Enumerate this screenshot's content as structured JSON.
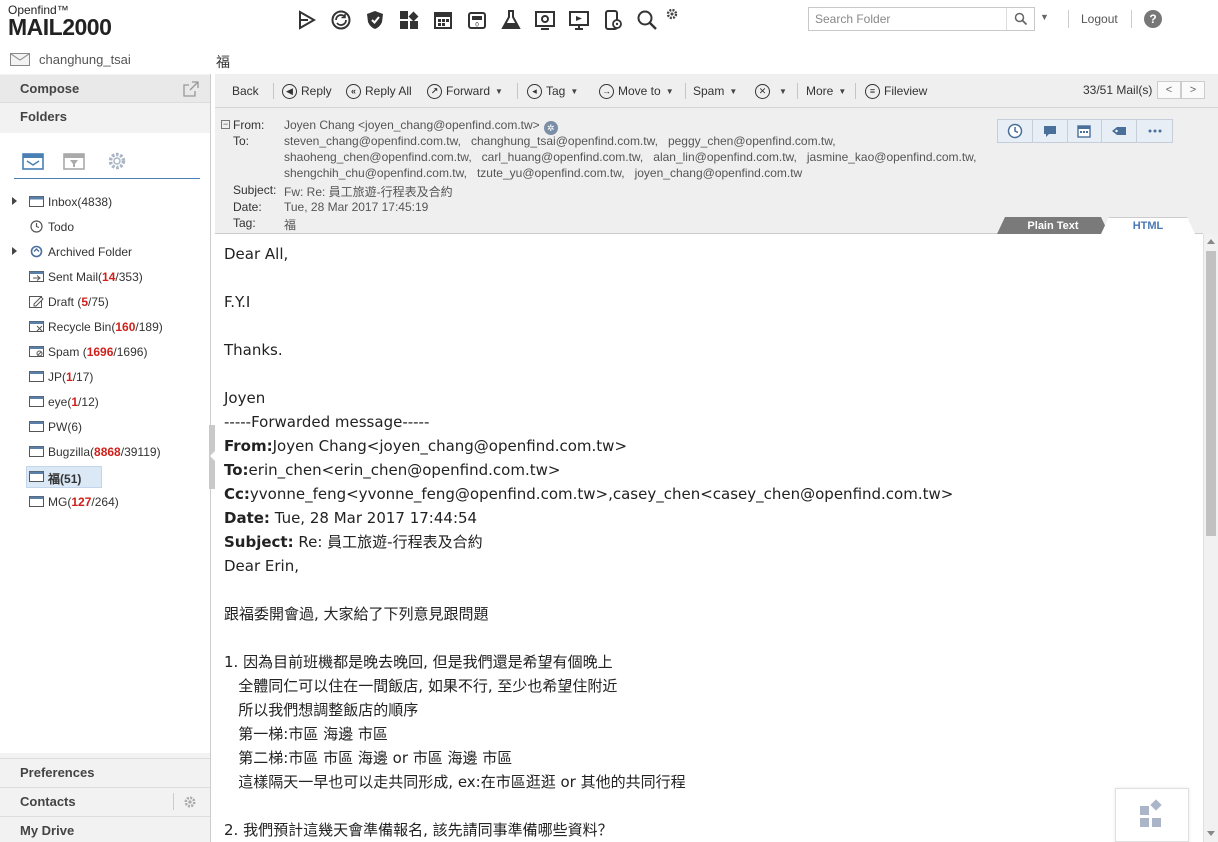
{
  "app": {
    "brand": "Openfind™",
    "product": "MAIL2000"
  },
  "top_icons": [
    "send-icon",
    "sync-icon",
    "shield-icon",
    "modules-icon",
    "calendar-icon",
    "calculator-icon",
    "lab-flask-icon",
    "settings-panel-icon",
    "presentation-icon",
    "phone-settings-icon",
    "search-icon",
    "gear-icon"
  ],
  "search": {
    "placeholder": "Search Folder",
    "value": ""
  },
  "header_links": {
    "logout": "Logout",
    "help": "?"
  },
  "user": {
    "name": "changhung_tsai"
  },
  "current_folder_title": "福",
  "sidebar": {
    "compose": "Compose",
    "folders": "Folders",
    "folder_tabs": [
      "mailbox-tab",
      "filter-tab",
      "settings-tab"
    ],
    "folders_list": [
      {
        "name": "Inbox",
        "pre": "(",
        "unread": "",
        "sep": "",
        "total": "4838",
        "post": ")",
        "expandable": true,
        "icon": "inbox-icon"
      },
      {
        "name": "Todo",
        "pre": "",
        "unread": "",
        "sep": "",
        "total": "",
        "post": "",
        "expandable": false,
        "icon": "clock-icon"
      },
      {
        "name": "Archived Folder",
        "pre": "",
        "unread": "",
        "sep": "",
        "total": "",
        "post": "",
        "expandable": true,
        "icon": "archive-icon"
      },
      {
        "name": "Sent Mail",
        "pre": "(",
        "unread": "14",
        "sep": "/",
        "total": "353",
        "post": ")",
        "expandable": false,
        "icon": "sent-icon"
      },
      {
        "name": "Draft ",
        "pre": "(",
        "unread": "5",
        "sep": "/",
        "total": "75",
        "post": ")",
        "expandable": false,
        "icon": "draft-icon"
      },
      {
        "name": "Recycle Bin",
        "pre": "(",
        "unread": "160",
        "sep": "/",
        "total": "189",
        "post": ")",
        "expandable": false,
        "icon": "recycle-bin-icon"
      },
      {
        "name": "Spam ",
        "pre": "(",
        "unread": "1696",
        "sep": "/",
        "total": "1696",
        "post": ")",
        "expandable": false,
        "icon": "spam-icon"
      },
      {
        "name": "JP",
        "pre": "(",
        "unread": "1",
        "sep": "/",
        "total": "17",
        "post": ")",
        "expandable": false,
        "icon": "folder-icon"
      },
      {
        "name": "eye",
        "pre": "(",
        "unread": "1",
        "sep": "/",
        "total": "12",
        "post": ")",
        "expandable": false,
        "icon": "folder-icon"
      },
      {
        "name": "PW",
        "pre": "(",
        "unread": "",
        "sep": "",
        "total": "6",
        "post": ")",
        "expandable": false,
        "icon": "folder-icon"
      },
      {
        "name": "Bugzilla",
        "pre": "(",
        "unread": "8868",
        "sep": "/",
        "total": "39119",
        "post": ")",
        "expandable": false,
        "icon": "folder-icon"
      },
      {
        "name": "福",
        "pre": "(",
        "unread": "",
        "sep": "",
        "total": "51",
        "post": ")",
        "expandable": false,
        "icon": "folder-icon",
        "selected": true
      },
      {
        "name": "MG",
        "pre": "(",
        "unread": "127",
        "sep": "/",
        "total": "264",
        "post": ")",
        "expandable": false,
        "icon": "folder-icon"
      }
    ],
    "preferences": "Preferences",
    "contacts": "Contacts",
    "my_drive": "My Drive"
  },
  "toolbar": {
    "back": "Back",
    "reply": "Reply",
    "reply_all": "Reply All",
    "forward": "Forward",
    "tag": "Tag",
    "move_to": "Move to",
    "spam": "Spam",
    "more": "More",
    "fileview": "Fileview",
    "mail_count": "33/51 Mail(s)",
    "prev": "<",
    "next": ">"
  },
  "header": {
    "from_label": "From:",
    "to_label": "To:",
    "subject_label": "Subject:",
    "date_label": "Date:",
    "tag_label": "Tag:",
    "from": "Joyen Chang <joyen_chang@openfind.com.tw>",
    "to_lines": [
      [
        "steven_chang@openfind.com.tw,",
        "changhung_tsai@openfind.com.tw,",
        "peggy_chen@openfind.com.tw,"
      ],
      [
        "shaoheng_chen@openfind.com.tw,",
        "carl_huang@openfind.com.tw,",
        "alan_lin@openfind.com.tw,",
        "jasmine_kao@openfind.com.tw,"
      ],
      [
        "shengchih_chu@openfind.com.tw,",
        "tzute_yu@openfind.com.tw,",
        "joyen_chang@openfind.com.tw"
      ]
    ],
    "subject": "Fw: Re: 員工旅遊-行程表及合約",
    "date": "Tue, 28 Mar 2017 17:45:19",
    "tag": "福",
    "actions": [
      "clock-icon",
      "chat-icon",
      "calendar-icon",
      "tag-icon",
      "more-icon"
    ],
    "view_plain": "Plain Text",
    "view_html": "HTML"
  },
  "body": {
    "greeting": "Dear All,",
    "fyi": "F.Y.I",
    "thanks": "Thanks.",
    "sign": "Joyen",
    "fwd_sep": "-----Forwarded message-----",
    "fwd_from_label": "From:",
    "fwd_from": "Joyen Chang<joyen_chang@openfind.com.tw>",
    "fwd_to_label": "To:",
    "fwd_to": "erin_chen<erin_chen@openfind.com.tw>",
    "fwd_cc_label": "Cc:",
    "fwd_cc": "yvonne_feng<yvonne_feng@openfind.com.tw>,casey_chen<casey_chen@openfind.com.tw>",
    "fwd_date_label": "Date:",
    "fwd_date": " Tue, 28 Mar 2017 17:44:54",
    "fwd_subject_label": "Subject:",
    "fwd_subject": " Re: 員工旅遊-行程表及合約",
    "dear_erin": "Dear Erin,",
    "p1": "跟福委開會過, 大家給了下列意見跟問題",
    "item1_l1": "1. 因為目前班機都是晚去晚回, 但是我們還是希望有個晚上",
    "item1_l2": "   全體同仁可以住在一間飯店, 如果不行, 至少也希望住附近",
    "item1_l3": "   所以我們想調整飯店的順序",
    "item1_l4": "   第一梯:市區 海邊 市區",
    "item1_l5": "   第二梯:市區 市區 海邊 or 市區 海邊 市區",
    "item1_l6": "   這樣隔天一早也可以走共同形成, ex:在市區逛逛 or 其他的共同行程",
    "item2_l1": "2. 我們預計這幾天會準備報名, 該先請同事準備哪些資料？"
  }
}
